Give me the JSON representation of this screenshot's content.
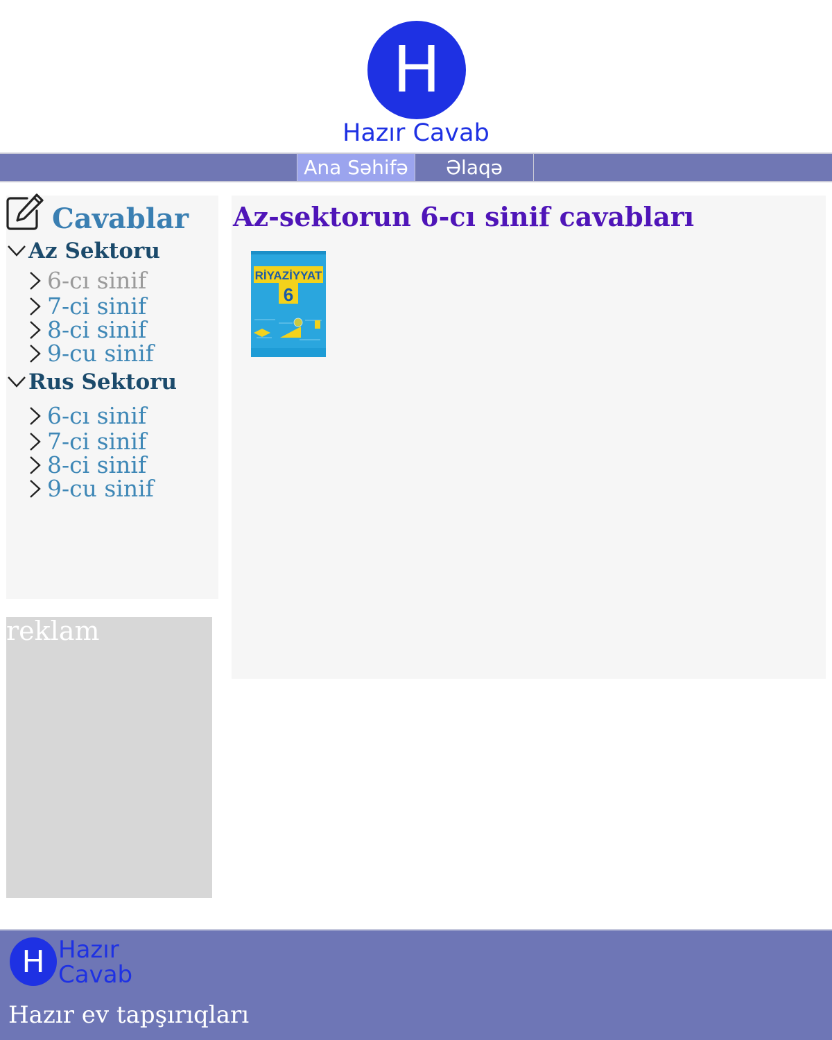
{
  "header": {
    "logo_letter": "H",
    "site_name": "Hazır Cavab"
  },
  "nav": {
    "items": [
      {
        "label": "Ana Səhifə",
        "active": true
      },
      {
        "label": "Əlaqə",
        "active": false
      }
    ]
  },
  "sidebar": {
    "title": "Cavablar",
    "title_icon": "edit-icon",
    "sectors": [
      {
        "label": "Az Sektoru",
        "expanded": true,
        "grades": [
          {
            "label": "6-cı sinif",
            "active": true
          },
          {
            "label": "7-ci sinif",
            "active": false
          },
          {
            "label": "8-ci sinif",
            "active": false
          },
          {
            "label": "9-cu sinif",
            "active": false
          }
        ]
      },
      {
        "label": "Rus Sektoru",
        "expanded": true,
        "grades": [
          {
            "label": "6-cı sinif",
            "active": false
          },
          {
            "label": "7-ci sinif",
            "active": false
          },
          {
            "label": "8-ci sinif",
            "active": false
          },
          {
            "label": "9-cu sinif",
            "active": false
          }
        ]
      }
    ]
  },
  "ad": {
    "label": "reklam"
  },
  "main": {
    "title": "Az-sektorun 6-cı sinif cavabları",
    "books": [
      {
        "title": "RİYAZİYYAT",
        "grade": "6"
      }
    ]
  },
  "footer": {
    "logo_letter": "H",
    "site_name": "Hazır Cavab",
    "tagline": "Hazır ev tapşırıqları"
  },
  "colors": {
    "brand_blue": "#1e31e3",
    "nav_bg": "#7077b4",
    "nav_active_bg": "#9ba4ee",
    "main_title": "#4f15b8",
    "link": "#3e87b6",
    "sector": "#1b4a6b"
  }
}
